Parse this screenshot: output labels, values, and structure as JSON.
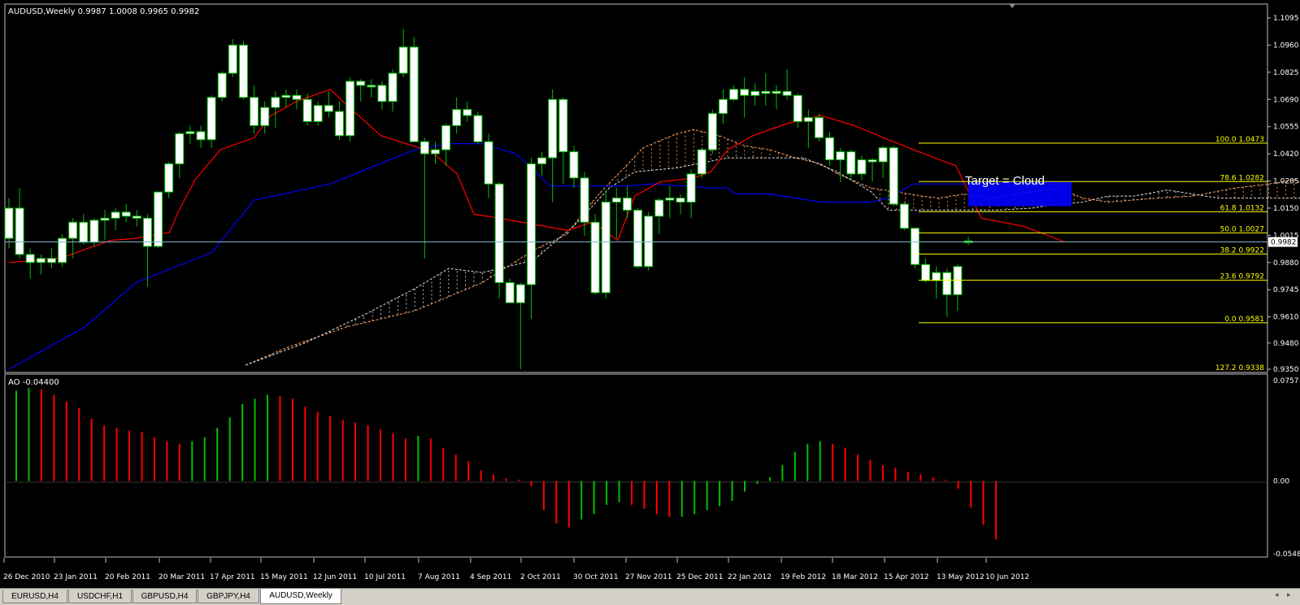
{
  "main_header": "AUDUSD,Weekly  0.9987 1.0008 0.9965 0.9982",
  "sub_header": "AO -0.04400",
  "annotation": "Target = Cloud",
  "price_badge": "0.9982",
  "price_axis": [
    "1.1095",
    "1.0960",
    "1.0825",
    "1.0690",
    "1.0555",
    "1.0420",
    "1.0285",
    "1.0150",
    "1.0015",
    "0.9880",
    "0.9745",
    "0.9610",
    "0.9480",
    "0.9350"
  ],
  "ao_axis": [
    "0.0757",
    "0.00",
    "-0.05486"
  ],
  "fib_levels": [
    {
      "label": "100.0 1.0473"
    },
    {
      "label": "78.6 1.0282"
    },
    {
      "label": "61.8 1.0132"
    },
    {
      "label": "50.0 1.0027"
    },
    {
      "label": "38.2 0.9922"
    },
    {
      "label": "23.6 0.9792"
    },
    {
      "label": "0.0 0.9581"
    },
    {
      "label": "127.2 0.9338"
    }
  ],
  "date_axis": [
    "26 Dec 2010",
    "23 Jan 2011",
    "20 Feb 2011",
    "20 Mar 2011",
    "17 Apr 2011",
    "15 May 2011",
    "12 Jun 2011",
    "10 Jul 2011",
    "7 Aug 2011",
    "4 Sep 2011",
    "2 Oct 2011",
    "30 Oct 2011",
    "27 Nov 2011",
    "25 Dec 2011",
    "22 Jan 2012",
    "19 Feb 2012",
    "18 Mar 2012",
    "15 Apr 2012",
    "13 May 2012",
    "10 Jun 2012"
  ],
  "tabs": [
    {
      "label": "EURUSD,H4",
      "active": false
    },
    {
      "label": "USDCHF,H1",
      "active": false
    },
    {
      "label": "GBPUSD,H4",
      "active": false
    },
    {
      "label": "GBPJPY,H4",
      "active": false
    },
    {
      "label": "AUDUSD,Weekly",
      "active": true
    }
  ],
  "colors": {
    "bull": "#ffffff",
    "bear": "#ffffff",
    "wick": "#00c000",
    "tenkan": "#ff0000",
    "kijun": "#0000ff",
    "cloud": "#ffa060",
    "fib": "#ffff00",
    "ao_up": "#00c000",
    "ao_down": "#ff0000",
    "target": "#0000ff"
  },
  "chart_data": {
    "type": "candlestick",
    "symbol": "AUDUSD",
    "timeframe": "Weekly",
    "ohlc_last": {
      "open": 0.9987,
      "high": 1.0008,
      "low": 0.9965,
      "close": 0.9982
    },
    "ylim": [
      0.935,
      1.1095
    ],
    "candles_ohlc": [
      [
        1.0,
        1.02,
        0.995,
        1.015
      ],
      [
        1.015,
        1.025,
        0.99,
        0.992
      ],
      [
        0.992,
        0.995,
        0.98,
        0.988
      ],
      [
        0.988,
        0.992,
        0.982,
        0.99
      ],
      [
        0.99,
        0.995,
        0.985,
        0.988
      ],
      [
        0.988,
        1.002,
        0.986,
        1.0
      ],
      [
        1.0,
        1.01,
        0.99,
        1.008
      ],
      [
        1.008,
        1.012,
        0.997,
        0.998
      ],
      [
        0.998,
        1.01,
        0.996,
        1.009
      ],
      [
        1.009,
        1.014,
        0.999,
        1.01
      ],
      [
        1.01,
        1.015,
        1.004,
        1.013
      ],
      [
        1.013,
        1.017,
        1.008,
        1.011
      ],
      [
        1.011,
        1.014,
        1.006,
        1.01
      ],
      [
        1.01,
        1.012,
        0.976,
        0.996
      ],
      [
        0.996,
        1.023,
        0.995,
        1.023
      ],
      [
        1.023,
        1.038,
        1.02,
        1.037
      ],
      [
        1.037,
        1.053,
        1.03,
        1.052
      ],
      [
        1.052,
        1.056,
        1.047,
        1.053
      ],
      [
        1.053,
        1.056,
        1.045,
        1.049
      ],
      [
        1.049,
        1.071,
        1.045,
        1.07
      ],
      [
        1.07,
        1.083,
        1.068,
        1.082
      ],
      [
        1.082,
        1.099,
        1.08,
        1.096
      ],
      [
        1.096,
        1.098,
        1.069,
        1.07
      ],
      [
        1.07,
        1.076,
        1.052,
        1.056
      ],
      [
        1.056,
        1.068,
        1.052,
        1.065
      ],
      [
        1.065,
        1.073,
        1.055,
        1.07
      ],
      [
        1.07,
        1.074,
        1.065,
        1.071
      ],
      [
        1.071,
        1.074,
        1.064,
        1.069
      ],
      [
        1.069,
        1.072,
        1.056,
        1.058
      ],
      [
        1.058,
        1.068,
        1.056,
        1.066
      ],
      [
        1.066,
        1.073,
        1.06,
        1.063
      ],
      [
        1.063,
        1.068,
        1.049,
        1.051
      ],
      [
        1.051,
        1.08,
        1.048,
        1.078
      ],
      [
        1.078,
        1.079,
        1.068,
        1.076
      ],
      [
        1.076,
        1.079,
        1.07,
        1.076
      ],
      [
        1.076,
        1.078,
        1.064,
        1.068
      ],
      [
        1.068,
        1.084,
        1.063,
        1.082
      ],
      [
        1.082,
        1.104,
        1.08,
        1.095
      ],
      [
        1.095,
        1.1,
        1.048,
        1.048
      ],
      [
        1.048,
        1.05,
        0.99,
        1.042
      ],
      [
        1.042,
        1.048,
        1.037,
        1.044
      ],
      [
        1.044,
        1.057,
        1.036,
        1.056
      ],
      [
        1.056,
        1.07,
        1.052,
        1.064
      ],
      [
        1.064,
        1.068,
        1.058,
        1.061
      ],
      [
        1.061,
        1.063,
        1.047,
        1.048
      ],
      [
        1.048,
        1.052,
        1.02,
        1.027
      ],
      [
        1.027,
        1.028,
        0.97,
        0.978
      ],
      [
        0.978,
        0.98,
        0.968,
        0.968
      ],
      [
        0.968,
        0.978,
        0.935,
        0.977
      ],
      [
        0.977,
        1.04,
        0.96,
        1.037
      ],
      [
        1.037,
        1.043,
        1.031,
        1.04
      ],
      [
        1.04,
        1.074,
        1.018,
        1.069
      ],
      [
        1.069,
        1.07,
        1.027,
        1.043
      ],
      [
        1.043,
        1.046,
        1.025,
        1.03
      ],
      [
        1.03,
        1.033,
        1.001,
        1.008
      ],
      [
        1.008,
        1.012,
        0.972,
        0.973
      ],
      [
        0.973,
        1.024,
        0.97,
        1.018
      ],
      [
        1.018,
        1.025,
        1.0,
        1.02
      ],
      [
        1.02,
        1.026,
        1.01,
        1.014
      ],
      [
        1.014,
        1.015,
        0.985,
        0.986
      ],
      [
        0.986,
        1.013,
        0.984,
        1.011
      ],
      [
        1.011,
        1.02,
        1.002,
        1.019
      ],
      [
        1.019,
        1.026,
        1.01,
        1.02
      ],
      [
        1.02,
        1.022,
        1.012,
        1.018
      ],
      [
        1.018,
        1.034,
        1.01,
        1.032
      ],
      [
        1.032,
        1.045,
        1.03,
        1.044
      ],
      [
        1.044,
        1.064,
        1.042,
        1.062
      ],
      [
        1.062,
        1.074,
        1.057,
        1.069
      ],
      [
        1.069,
        1.076,
        1.068,
        1.074
      ],
      [
        1.074,
        1.08,
        1.06,
        1.071
      ],
      [
        1.071,
        1.077,
        1.066,
        1.073
      ],
      [
        1.073,
        1.082,
        1.066,
        1.072
      ],
      [
        1.072,
        1.076,
        1.064,
        1.073
      ],
      [
        1.073,
        1.084,
        1.069,
        1.071
      ],
      [
        1.071,
        1.072,
        1.055,
        1.058
      ],
      [
        1.058,
        1.064,
        1.045,
        1.06
      ],
      [
        1.06,
        1.062,
        1.048,
        1.05
      ],
      [
        1.05,
        1.053,
        1.036,
        1.039
      ],
      [
        1.039,
        1.045,
        1.028,
        1.043
      ],
      [
        1.043,
        1.044,
        1.029,
        1.032
      ],
      [
        1.032,
        1.041,
        1.029,
        1.039
      ],
      [
        1.039,
        1.04,
        1.028,
        1.038
      ],
      [
        1.038,
        1.046,
        1.03,
        1.045
      ],
      [
        1.045,
        1.046,
        1.016,
        1.017
      ],
      [
        1.017,
        1.018,
        1.004,
        1.005
      ],
      [
        1.005,
        1.005,
        0.985,
        0.987
      ],
      [
        0.987,
        0.99,
        0.978,
        0.979
      ],
      [
        0.979,
        0.986,
        0.97,
        0.983
      ],
      [
        0.983,
        0.985,
        0.961,
        0.972
      ],
      [
        0.972,
        0.987,
        0.964,
        0.986
      ],
      [
        0.9987,
        1.0008,
        0.9965,
        0.9982
      ]
    ],
    "tenkan_sen": [
      [
        0,
        0.988
      ],
      [
        6,
        0.99
      ],
      [
        12,
        0.999
      ],
      [
        15,
        1.0
      ],
      [
        19,
        1.003
      ],
      [
        20,
        1.013
      ],
      [
        22,
        1.029
      ],
      [
        25,
        1.044
      ],
      [
        29,
        1.05
      ],
      [
        31,
        1.061
      ],
      [
        34,
        1.068
      ],
      [
        38,
        1.074
      ],
      [
        40,
        1.066
      ],
      [
        44,
        1.051
      ],
      [
        50,
        1.043
      ],
      [
        53,
        1.032
      ],
      [
        55,
        1.012
      ],
      [
        58,
        1.01
      ],
      [
        66,
        1.004
      ],
      [
        69,
        1.008
      ],
      [
        72,
        0.999
      ],
      [
        74,
        1.021
      ],
      [
        77,
        1.028
      ],
      [
        81,
        1.03
      ],
      [
        83,
        1.033
      ],
      [
        85,
        1.044
      ],
      [
        88,
        1.051
      ],
      [
        92,
        1.057
      ],
      [
        96,
        1.061
      ],
      [
        100,
        1.056
      ],
      [
        104,
        1.049
      ],
      [
        107,
        1.044
      ],
      [
        112,
        1.036
      ],
      [
        115,
        1.01
      ],
      [
        120,
        1.006
      ],
      [
        125,
        0.998
      ]
    ],
    "kijun_sen": [
      [
        0,
        0.935
      ],
      [
        3,
        0.942
      ],
      [
        9,
        0.956
      ],
      [
        15,
        0.978
      ],
      [
        24,
        0.993
      ],
      [
        29,
        1.019
      ],
      [
        38,
        1.027
      ],
      [
        48,
        1.044
      ],
      [
        52,
        1.047
      ],
      [
        56,
        1.047
      ],
      [
        60,
        1.042
      ],
      [
        64,
        1.026
      ],
      [
        68,
        1.026
      ],
      [
        73,
        1.026
      ],
      [
        76,
        1.027
      ],
      [
        80,
        1.026
      ],
      [
        83,
        1.025
      ],
      [
        85,
        1.025
      ],
      [
        86,
        1.022
      ],
      [
        90,
        1.022
      ],
      [
        96,
        1.018
      ],
      [
        102,
        1.018
      ],
      [
        104,
        1.02
      ],
      [
        107,
        1.027
      ],
      [
        110,
        1.027
      ],
      [
        115,
        1.027
      ]
    ],
    "senkou_a": [
      [
        28,
        0.937
      ],
      [
        33,
        0.946
      ],
      [
        40,
        0.956
      ],
      [
        48,
        0.964
      ],
      [
        56,
        0.978
      ],
      [
        62,
        0.994
      ],
      [
        66,
        1.002
      ],
      [
        68,
        1.013
      ],
      [
        70,
        1.023
      ],
      [
        73,
        1.036
      ],
      [
        75,
        1.045
      ],
      [
        79,
        1.052
      ],
      [
        81,
        1.054
      ],
      [
        84,
        1.051
      ],
      [
        87,
        1.046
      ],
      [
        90,
        1.044
      ],
      [
        93,
        1.04
      ],
      [
        96,
        1.037
      ],
      [
        98,
        1.032
      ],
      [
        102,
        1.025
      ],
      [
        105,
        1.023
      ],
      [
        108,
        1.021
      ],
      [
        110,
        1.02
      ],
      [
        113,
        1.022
      ],
      [
        116,
        1.02
      ],
      [
        121,
        1.023
      ],
      [
        124,
        1.025
      ],
      [
        127,
        1.02
      ],
      [
        130,
        1.018
      ],
      [
        133,
        1.019
      ],
      [
        136,
        1.02
      ],
      [
        140,
        1.021
      ],
      [
        145,
        1.025
      ],
      [
        149,
        1.027
      ],
      [
        152,
        1.029
      ],
      [
        155,
        1.023
      ]
    ],
    "senkou_b": [
      [
        28,
        0.937
      ],
      [
        35,
        0.948
      ],
      [
        42,
        0.962
      ],
      [
        48,
        0.975
      ],
      [
        52,
        0.985
      ],
      [
        56,
        0.983
      ],
      [
        62,
        0.989
      ],
      [
        67,
        1.007
      ],
      [
        71,
        1.025
      ],
      [
        74,
        1.033
      ],
      [
        79,
        1.035
      ],
      [
        85,
        1.04
      ],
      [
        90,
        1.04
      ],
      [
        94,
        1.04
      ],
      [
        98,
        1.033
      ],
      [
        102,
        1.023
      ],
      [
        104,
        1.014
      ],
      [
        108,
        1.014
      ],
      [
        113,
        1.014
      ],
      [
        117,
        1.014
      ],
      [
        121,
        1.015
      ],
      [
        124,
        1.017
      ],
      [
        127,
        1.018
      ],
      [
        130,
        1.021
      ],
      [
        133,
        1.021
      ],
      [
        137,
        1.024
      ],
      [
        140,
        1.022
      ],
      [
        143,
        1.02
      ],
      [
        147,
        1.02
      ],
      [
        151,
        1.02
      ],
      [
        155,
        1.02
      ]
    ],
    "ao_values": [
      0.068,
      0.07,
      0.069,
      0.065,
      0.06,
      0.055,
      0.047,
      0.042,
      0.04,
      0.038,
      0.037,
      0.033,
      0.03,
      0.028,
      0.03,
      0.033,
      0.04,
      0.048,
      0.058,
      0.062,
      0.065,
      0.064,
      0.062,
      0.056,
      0.052,
      0.049,
      0.046,
      0.044,
      0.042,
      0.039,
      0.036,
      0.032,
      0.034,
      0.032,
      0.025,
      0.02,
      0.015,
      0.008,
      0.005,
      0.002,
      0.001,
      -0.004,
      -0.022,
      -0.032,
      -0.035,
      -0.029,
      -0.025,
      -0.018,
      -0.016,
      -0.018,
      -0.021,
      -0.025,
      -0.027,
      -0.027,
      -0.025,
      -0.022,
      -0.019,
      -0.015,
      -0.008,
      -0.002,
      0.003,
      0.012,
      0.022,
      0.028,
      0.03,
      0.028,
      0.025,
      0.02,
      0.016,
      0.012,
      0.01,
      0.007,
      0.005,
      0.003,
      0.001,
      -0.006,
      -0.02,
      -0.033,
      -0.044
    ],
    "fib_values": [
      1.0473,
      1.0282,
      1.0132,
      1.0027,
      0.9922,
      0.9792,
      0.9581,
      0.9338
    ],
    "target_zone": {
      "top": 1.028,
      "bottom": 1.016
    },
    "current_price": 0.9982
  }
}
